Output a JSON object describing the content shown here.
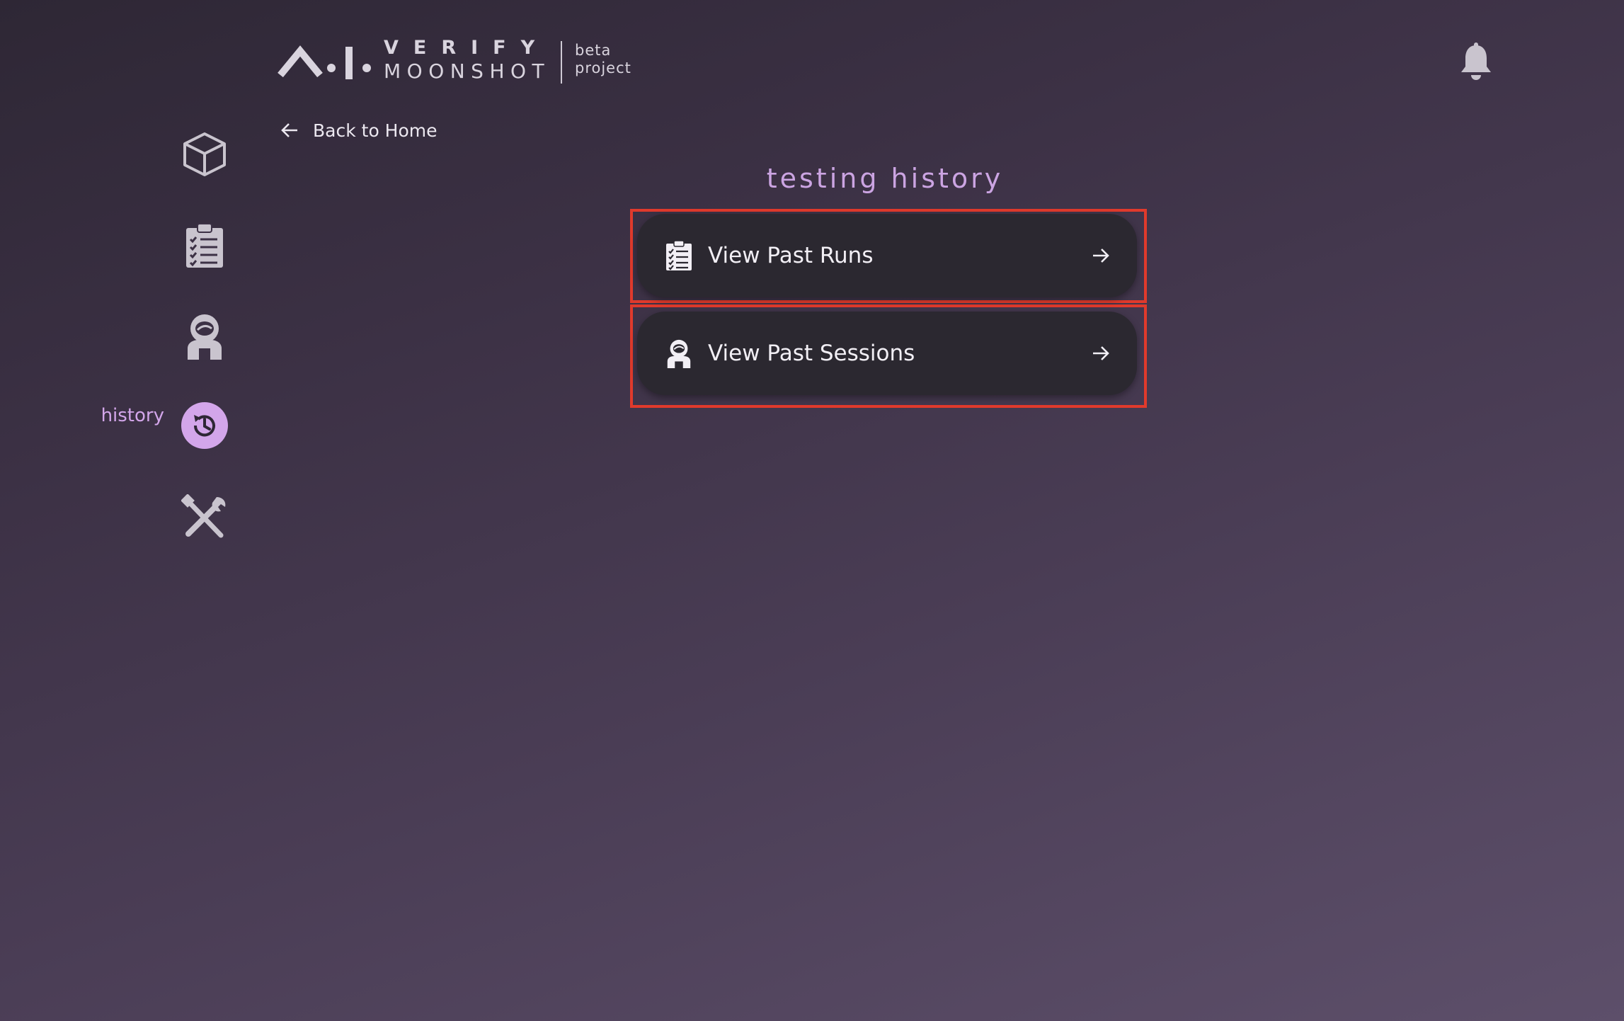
{
  "header": {
    "logo_word_top": "VERIFY",
    "logo_word_bottom": "MOONSHOT",
    "logo_badge_line1": "beta",
    "logo_badge_line2": "project"
  },
  "back_link": {
    "label": "Back to Home"
  },
  "sidebar": {
    "items": [
      {
        "name": "cube-icon",
        "label": ""
      },
      {
        "name": "clipboard-checklist-icon",
        "label": ""
      },
      {
        "name": "astronaut-icon",
        "label": ""
      },
      {
        "name": "history-icon",
        "label": "history",
        "active": true
      },
      {
        "name": "tools-icon",
        "label": ""
      }
    ]
  },
  "main": {
    "heading": "testing history",
    "actions": [
      {
        "label": "View Past Runs",
        "icon": "clipboard-checklist-icon",
        "arrow": "arrow-right-icon"
      },
      {
        "label": "View Past Sessions",
        "icon": "astronaut-icon",
        "arrow": "arrow-right-icon"
      }
    ]
  },
  "colors": {
    "accent": "#cba4e2",
    "active_nav_bg": "#d3a6ea",
    "highlight_border": "#e03a2c",
    "button_bg": "#2b2830",
    "icon_gray": "#c9c4ce"
  }
}
